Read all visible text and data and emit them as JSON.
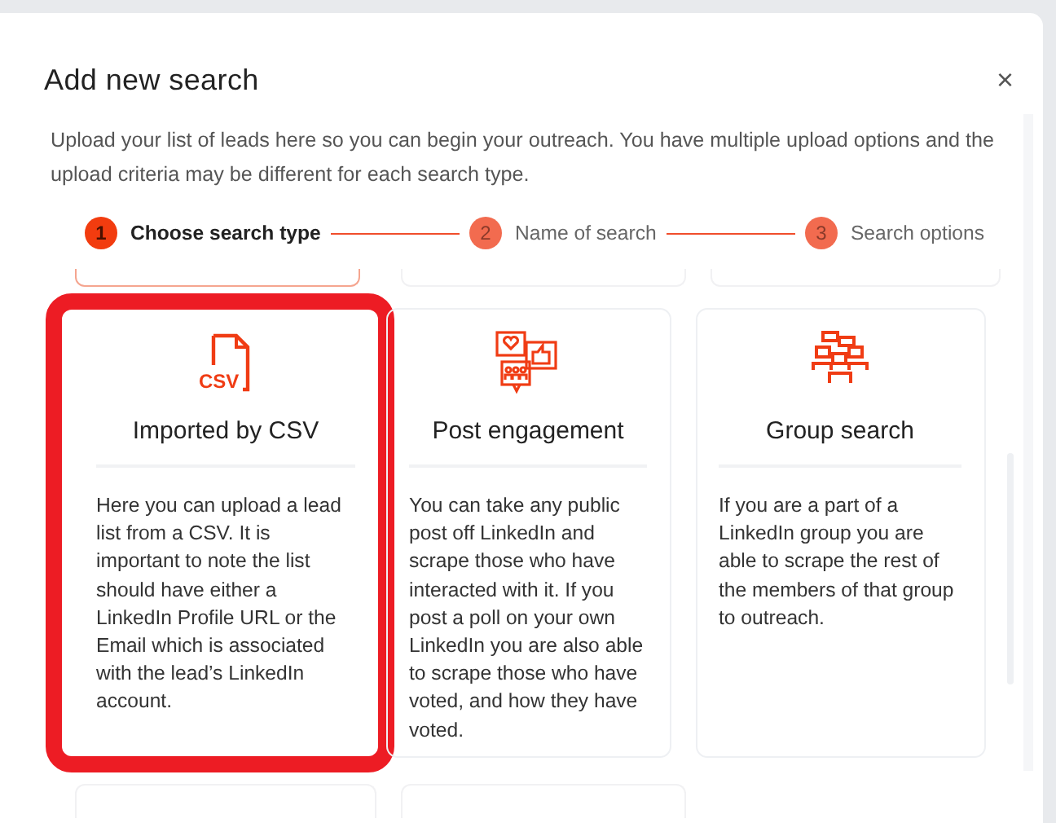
{
  "dialog": {
    "title": "Add new search",
    "close": "×",
    "description": "Upload your list of leads here so you can begin your outreach. You have multiple upload options and the upload criteria may be different for each search type."
  },
  "steps": [
    {
      "number": "1",
      "label": "Choose search type",
      "selected": true
    },
    {
      "number": "2",
      "label": "Name of search",
      "selected": false
    },
    {
      "number": "3",
      "label": "Search options",
      "selected": false
    }
  ],
  "cards": [
    {
      "kind": "csv",
      "icon_text": "CSV",
      "title": "Imported by CSV",
      "text": "Here you can upload a lead list from a CSV. It is important to note the list should have either a LinkedIn Profile URL or the Email which is associated with the lead’s LinkedIn account.",
      "highlighted": true
    },
    {
      "kind": "engagement",
      "title": "Post engagement",
      "text": "You can take any public post off LinkedIn and scrape those who have interacted with it. If you post a poll on your own LinkedIn you are also able to scrape those who have voted, and how they have voted.",
      "highlighted": false
    },
    {
      "kind": "group",
      "title": "Group search",
      "text": "If you are a part of a LinkedIn group you are able to scrape the rest of the members of that group to outreach.",
      "highlighted": false
    }
  ]
}
